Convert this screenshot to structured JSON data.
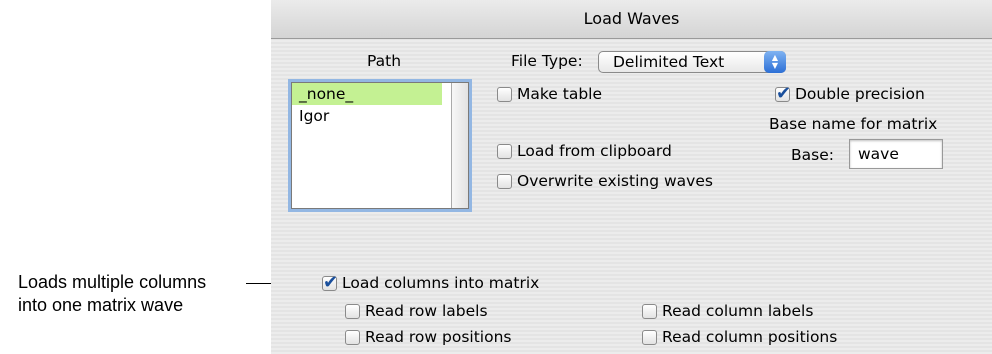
{
  "callout": {
    "line1": "Loads multiple columns",
    "line2": "into one matrix wave"
  },
  "dialog": {
    "title": "Load Waves",
    "path": {
      "label": "Path",
      "items": [
        {
          "label": "_none_",
          "selected": true
        },
        {
          "label": "Igor",
          "selected": false
        }
      ]
    },
    "file_type": {
      "label": "File Type:",
      "value": "Delimited Text"
    },
    "options": {
      "make_table": {
        "label": "Make table",
        "checked": false
      },
      "load_from_clipboard": {
        "label": "Load from clipboard",
        "checked": false
      },
      "overwrite_existing": {
        "label": "Overwrite existing waves",
        "checked": false
      },
      "double_precision": {
        "label": "Double precision",
        "checked": true
      }
    },
    "base_name": {
      "heading": "Base name for matrix",
      "label": "Base:",
      "value": "wave"
    },
    "matrix": {
      "load_columns_into_matrix": {
        "label": "Load columns into matrix",
        "checked": true
      },
      "read_row_labels": {
        "label": "Read row labels",
        "checked": false
      },
      "read_row_positions": {
        "label": "Read row positions",
        "checked": false
      },
      "read_column_labels": {
        "label": "Read column labels",
        "checked": false
      },
      "read_column_positions": {
        "label": "Read column positions",
        "checked": false
      }
    }
  }
}
